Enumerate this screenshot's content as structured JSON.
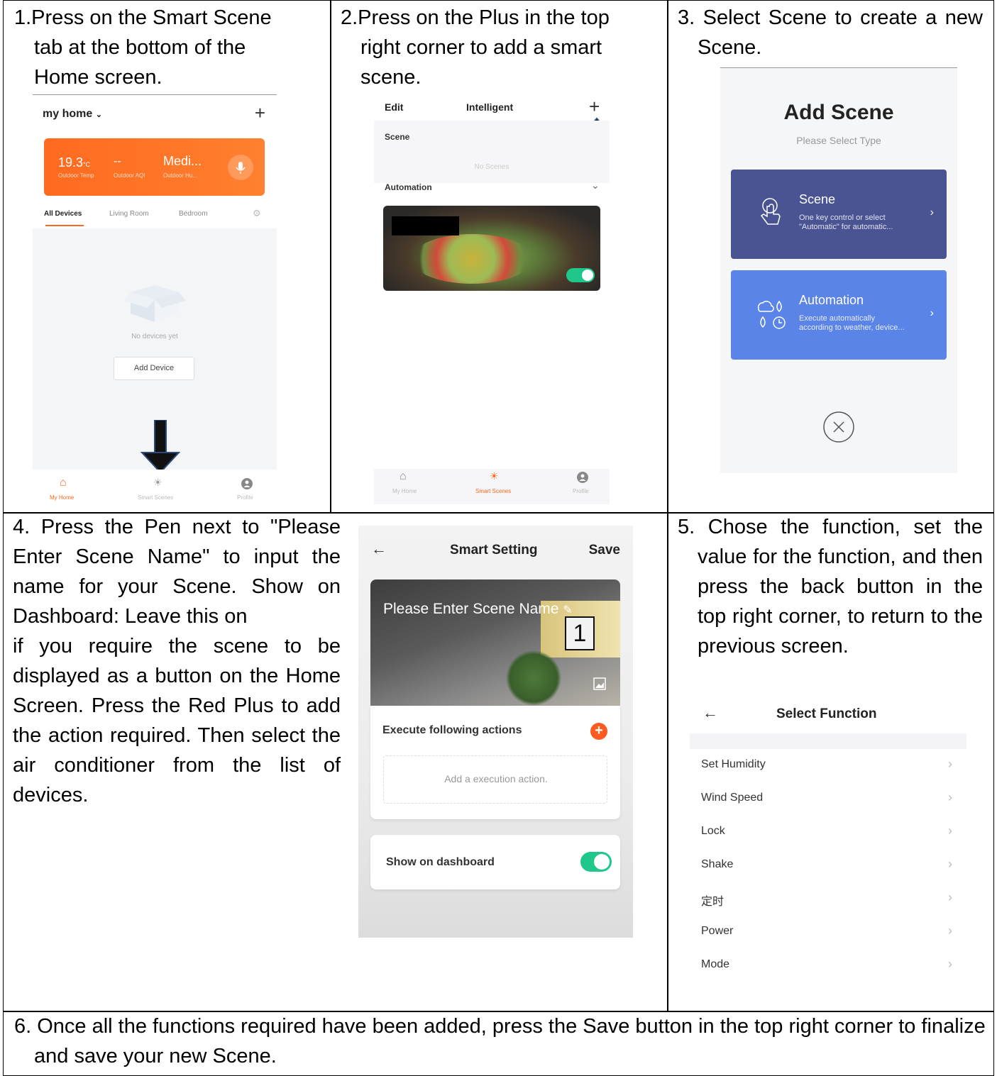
{
  "steps": [
    {
      "text": "1.Press on the Smart Scene tab at the bottom of the Home screen."
    },
    {
      "text": "2.Press on the Plus in the top right corner to add a smart scene."
    },
    {
      "text": "3. Select Scene to create a new Scene."
    },
    {
      "text": "4. Press the Pen next to \"Please Enter Scene Name\" to input the name for your Scene. Show on Dashboard: Leave this on",
      "text2": "if you require the scene to be displayed as a button on the Home Screen. Press the Red Plus to add the action required. Then select the air conditioner from the list of devices."
    },
    {
      "text": "5. Chose the function, set the value for the function, and then press the back button in the top right corner, to return to the previous screen."
    },
    {
      "text": "6. Once all the functions required have been added, press the Save button in the top right corner to finalize and save your new Scene."
    }
  ],
  "screen1": {
    "home_title": "my home",
    "plus": "+",
    "temp": "19.3",
    "temp_unit": "°C",
    "aqi": "--",
    "humidity": "Medi...",
    "temp_label": "Outdoor Temp",
    "aqi_label": "Outdoor AQI",
    "hum_label": "Outdoor Hu...",
    "tabs": [
      "All Devices",
      "Living Room",
      "Bedroom"
    ],
    "empty": "No devices yet",
    "add_device": "Add Device",
    "nav": [
      "My Home",
      "Smart Scenes",
      "Profile"
    ],
    "accent": "#ff6a1f"
  },
  "screen2": {
    "edit": "Edit",
    "title": "Intelligent",
    "plus": "+",
    "scene": "Scene",
    "no_scenes": "No Scenes",
    "automation": "Automation",
    "nav": [
      "My Home",
      "Smart Scenes",
      "Profile"
    ],
    "toggle_color": "#1fc88a"
  },
  "screen3": {
    "title": "Add Scene",
    "subtitle": "Please Select Type",
    "scene_title": "Scene",
    "scene_desc1": "One key control or select",
    "scene_desc2": "\"Automatic\" for automatic...",
    "auto_title": "Automation",
    "auto_desc1": "Execute automatically",
    "auto_desc2": "according to weather, device...",
    "scene_color": "#4a5493",
    "auto_color": "#5b84e8"
  },
  "screen4": {
    "title": "Smart Setting",
    "save": "Save",
    "scene_name": "Please Enter Scene Name",
    "badge": "1",
    "execute": "Execute following actions",
    "add_action": "Add a execution action.",
    "show_dashboard": "Show on dashboard",
    "plus_color": "#ff5a1f",
    "toggle_color": "#1fc88a"
  },
  "screen5": {
    "title": "Select Function",
    "functions": [
      "Set Humidity",
      "Wind Speed",
      "Lock",
      "Shake",
      "定时",
      "Power",
      "Mode"
    ]
  }
}
